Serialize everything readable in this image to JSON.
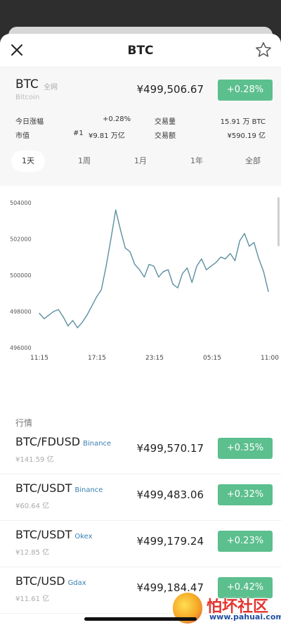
{
  "header": {
    "title": "BTC"
  },
  "icons": {
    "close": "close-icon",
    "favorite": "star-icon"
  },
  "colors": {
    "accent_green": "#5cbf8e",
    "line": "#5b8fa0",
    "exchange_text": "#3a7fb0"
  },
  "coin": {
    "symbol": "BTC",
    "scope_tag": "全网",
    "name": "Bitcoin",
    "price": "¥499,506.67",
    "change": "+0.28%"
  },
  "stats": {
    "today_change_label": "今日涨幅",
    "today_change_value": "+0.28%",
    "volume_label": "交易量",
    "volume_value": "15.91 万 BTC",
    "market_cap_label": "市值",
    "market_cap_rank": "#1",
    "market_cap_value": "¥9.81 万亿",
    "turnover_label": "交易额",
    "turnover_value": "¥590.19 亿"
  },
  "ranges": [
    "1天",
    "1周",
    "1月",
    "1年",
    "全部"
  ],
  "active_range": "1天",
  "chart_data": {
    "type": "line",
    "y_ticks": [
      "504000",
      "502000",
      "500000",
      "498000",
      "496000"
    ],
    "x_ticks": [
      "11:15",
      "17:15",
      "23:15",
      "05:15",
      "11:00"
    ],
    "ylim": [
      496000,
      504000
    ],
    "x": [
      "11:15",
      "11:45",
      "12:15",
      "12:45",
      "13:15",
      "13:45",
      "14:15",
      "14:45",
      "15:15",
      "15:45",
      "16:15",
      "16:45",
      "17:15",
      "17:45",
      "18:15",
      "18:45",
      "19:15",
      "19:45",
      "20:15",
      "20:45",
      "21:15",
      "21:45",
      "22:15",
      "22:45",
      "23:15",
      "23:45",
      "00:15",
      "00:45",
      "01:15",
      "01:45",
      "02:15",
      "02:45",
      "03:15",
      "03:45",
      "04:15",
      "04:45",
      "05:15",
      "05:45",
      "06:15",
      "06:45",
      "07:15",
      "07:45",
      "08:15",
      "08:45",
      "09:15",
      "09:45",
      "10:15",
      "10:45",
      "11:00"
    ],
    "values": [
      497900,
      497600,
      497800,
      498000,
      498100,
      497700,
      497200,
      497500,
      497100,
      497400,
      497800,
      498300,
      498800,
      499200,
      500500,
      502000,
      503600,
      502500,
      501500,
      501300,
      500600,
      500300,
      499900,
      500600,
      500500,
      499900,
      500200,
      500300,
      499500,
      499300,
      500100,
      500400,
      499600,
      500500,
      500900,
      500300,
      500500,
      500700,
      501000,
      500900,
      501200,
      500800,
      501900,
      502300,
      501600,
      501800,
      500900,
      500200,
      499100
    ]
  },
  "markets": {
    "section_label": "行情",
    "rows": [
      {
        "pair": "BTC/FDUSD",
        "exchange": "Binance",
        "volume": "¥141.59 亿",
        "price": "¥499,570.17",
        "change": "+0.35%"
      },
      {
        "pair": "BTC/USDT",
        "exchange": "Binance",
        "volume": "¥60.64 亿",
        "price": "¥499,483.06",
        "change": "+0.32%"
      },
      {
        "pair": "BTC/USDT",
        "exchange": "Okex",
        "volume": "¥12.85 亿",
        "price": "¥499,179.24",
        "change": "+0.23%"
      },
      {
        "pair": "BTC/USD",
        "exchange": "Gdax",
        "volume": "¥11.61 亿",
        "price": "¥499,184.47",
        "change": "+0.42%"
      }
    ]
  },
  "watermark": {
    "brand": "怕坏社区",
    "site": "www.pahuai.com"
  }
}
